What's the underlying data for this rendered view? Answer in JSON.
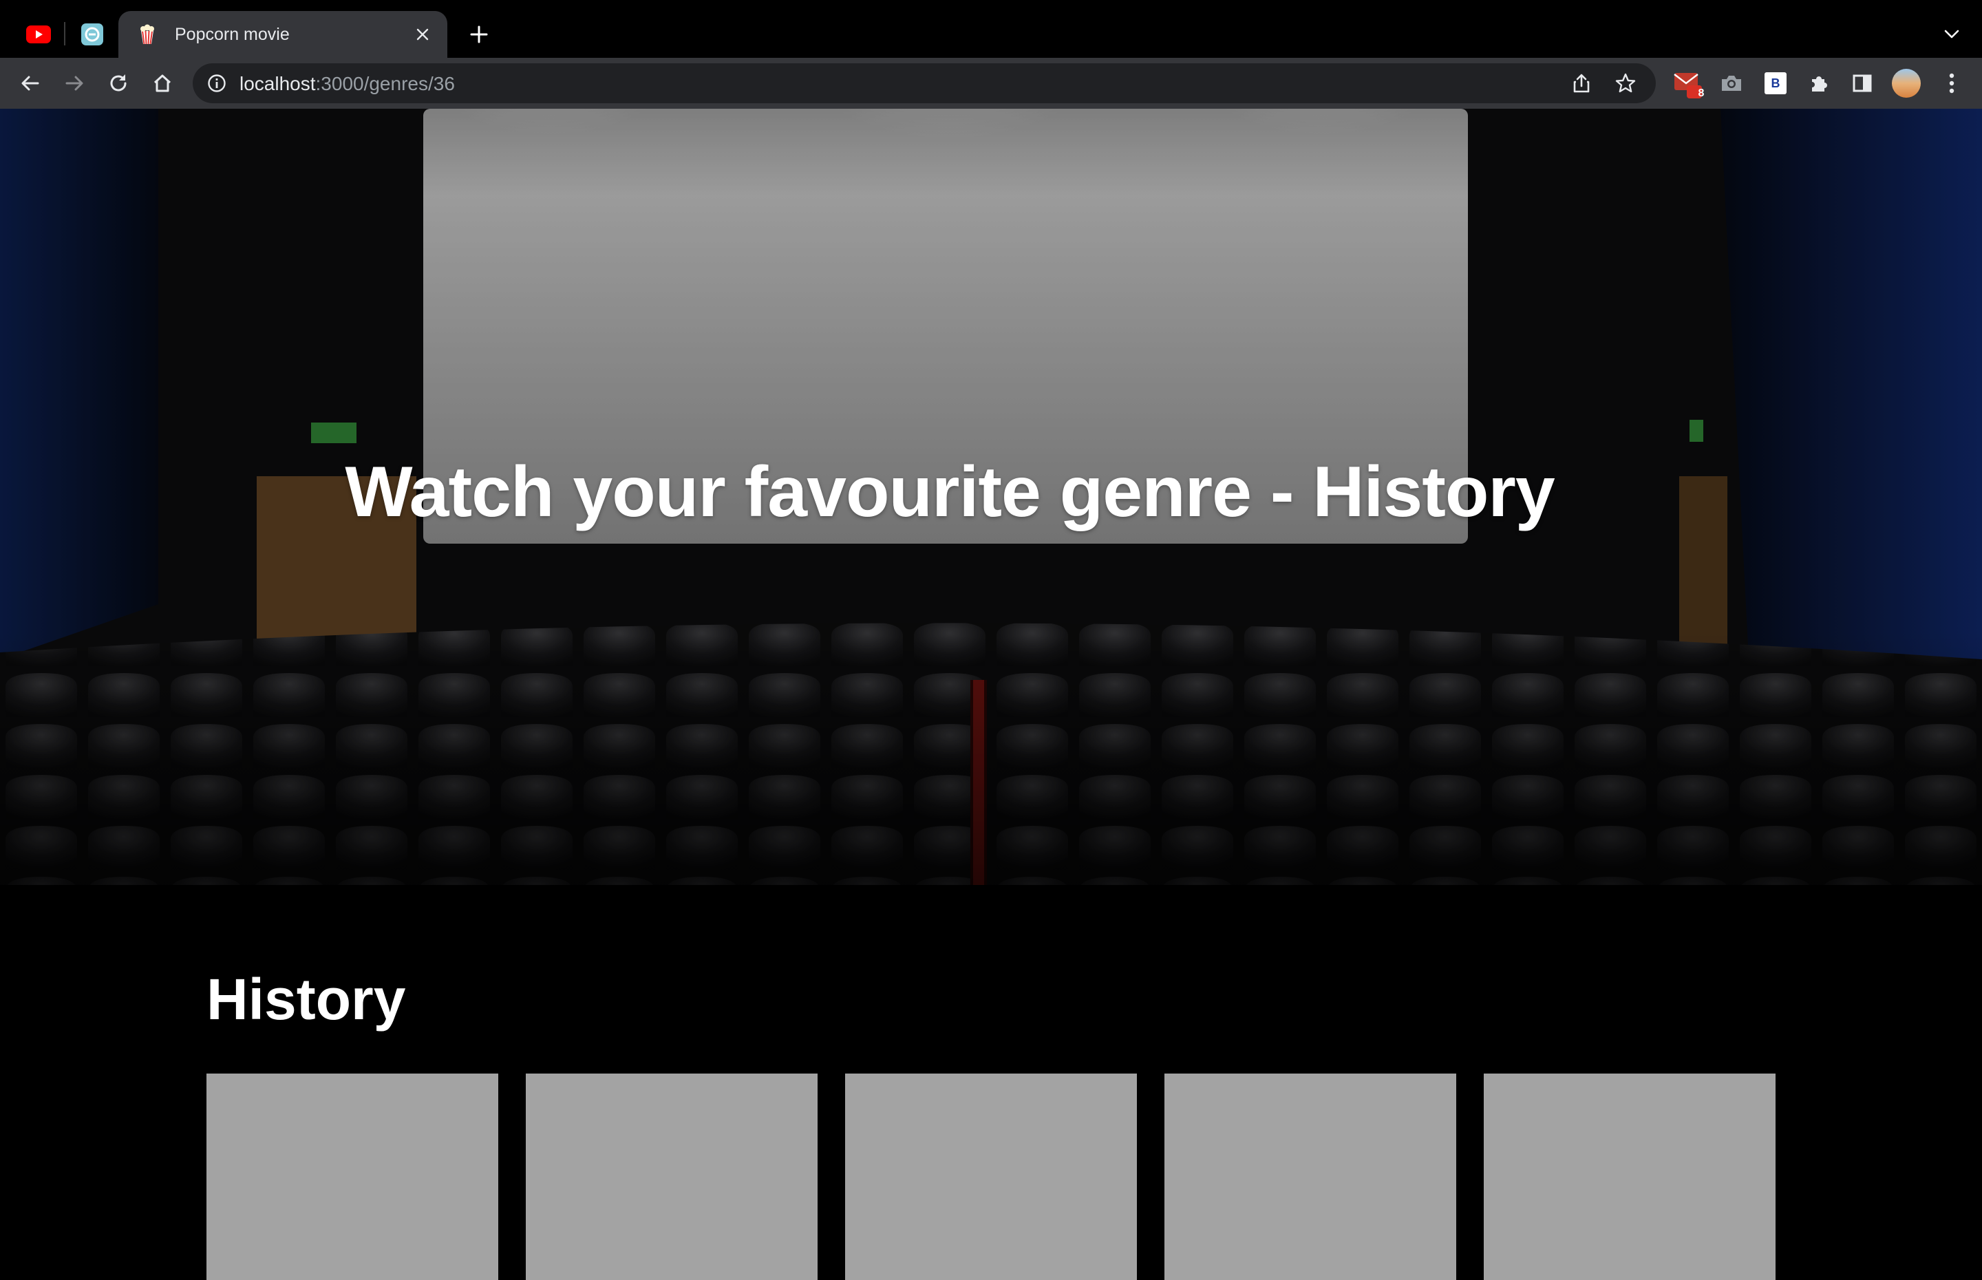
{
  "browser": {
    "pinned_tabs": [
      {
        "name": "YouTube",
        "icon": "youtube-icon"
      },
      {
        "name": "Tab",
        "icon": "app-icon"
      }
    ],
    "active_tab": {
      "title": "Popcorn movie",
      "icon": "popcorn-icon"
    },
    "address": {
      "host": "localhost",
      "rest": ":3000/genres/36"
    },
    "extensions": {
      "mail_badge": "8",
      "b_label": "B"
    }
  },
  "hero": {
    "title": "Watch your favourite genre - History"
  },
  "section": {
    "title": "History",
    "cards": [
      {
        "id": 1
      },
      {
        "id": 2
      },
      {
        "id": 3
      },
      {
        "id": 4
      },
      {
        "id": 5
      }
    ]
  },
  "colors": {
    "chrome_bg": "#000000",
    "toolbar_bg": "#35363a",
    "omnibox_bg": "#202124",
    "page_bg": "#000000",
    "card_placeholder": "#a3a3a3"
  }
}
